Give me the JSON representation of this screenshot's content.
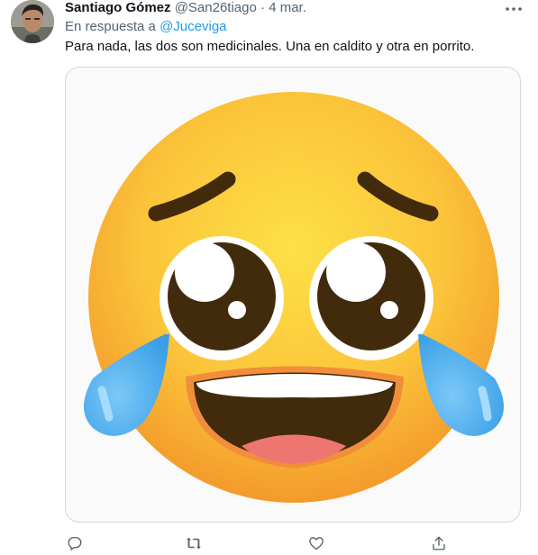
{
  "tweet": {
    "author_name": "Santiago Gómez",
    "handle": "@San26tiago",
    "separator": "·",
    "time": "4 mar.",
    "reply_prefix": "En respuesta a",
    "reply_mention": "@Juceviga",
    "text": "Para nada, las dos son medicinales. Una en caldito y otra en porrito."
  },
  "media": {
    "emoji": "face-holding-back-tears-laughing-icon"
  },
  "actions": {
    "reply_icon": "reply-icon",
    "retweet_icon": "retweet-icon",
    "like_icon": "heart-icon",
    "share_icon": "share-icon"
  },
  "colors": {
    "accent": "#1d9bf0",
    "secondary_text": "#536471",
    "emoji_yellow": "#fccc3c",
    "tear_blue": "#4fb2f1"
  }
}
